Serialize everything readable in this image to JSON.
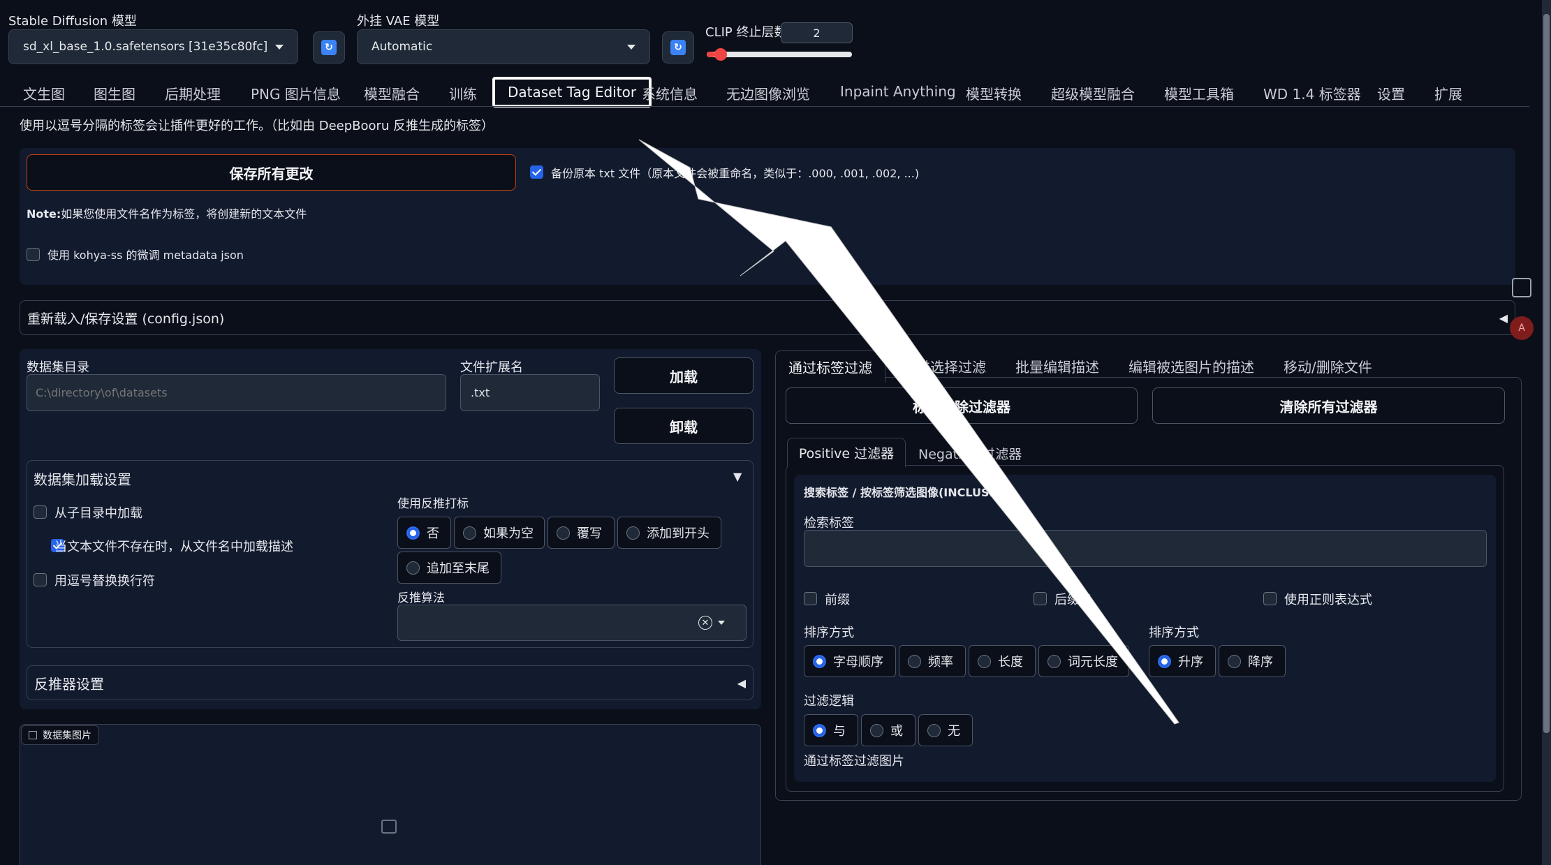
{
  "models": {
    "sd_label": "Stable Diffusion 模型",
    "sd_value": "sd_xl_base_1.0.safetensors [31e35c80fc]",
    "vae_label": "外挂 VAE 模型",
    "vae_value": "Automatic",
    "clip_label": "CLIP 终止层数",
    "clip_value": "2",
    "clip_fraction": 0.06
  },
  "tabs": [
    "文生图",
    "图生图",
    "后期处理",
    "PNG 图片信息",
    "模型融合",
    "训练",
    "Dataset Tag Editor",
    "系统信息",
    "无边图像浏览",
    "Inpaint Anything",
    "模型转换",
    "超级模型融合",
    "模型工具箱",
    "WD 1.4 标签器",
    "设置",
    "扩展"
  ],
  "active_tab": "Dataset Tag Editor",
  "intro": "使用以逗号分隔的标签会让插件更好的工作。（比如由 DeepBooru 反推生成的标签）",
  "save": {
    "button": "保存所有更改",
    "backup_label": "备份原本 txt 文件（原本文件会被重命名，类似于：.000, .001, .002, ...)",
    "note_bold": "Note:",
    "note": "如果您使用文件名作为标签，将创建新的文本文件",
    "kohya_label": "使用 kohya-ss 的微调 metadata json"
  },
  "config_accordion": "重新载入/保存设置 (config.json)",
  "dataset": {
    "dir_label": "数据集目录",
    "dir_placeholder": "C:\\directory\\of\\datasets",
    "ext_label": "文件扩展名",
    "ext_value": ".txt",
    "load": "加载",
    "unload": "卸载"
  },
  "load_settings": {
    "title": "数据集加载设置",
    "opt1": "从子目录中加载",
    "opt2": "当文本文件不存在时，从文件名中加载描述",
    "opt3": "用逗号替换换行符",
    "interrogate_label": "使用反推打标",
    "interrogate_opts": [
      "否",
      "如果为空",
      "覆写",
      "添加到开头",
      "追加至末尾"
    ],
    "algo_label": "反推算法"
  },
  "interrogator_settings": "反推器设置",
  "gallery_label": "数据集图片",
  "right": {
    "tabs": [
      "通过标签过滤",
      "通过选择过滤",
      "批量编辑描述",
      "编辑被选图片的描述",
      "移动/删除文件"
    ],
    "clear_tag_filter": "标签清除过滤器",
    "clear_all_filters": "清除所有过滤器",
    "subtabs": [
      "Positive 过滤器",
      "Negative 过滤器"
    ],
    "search_title": "搜索标签 / 按标签筛选图像(INCLUSIVE)",
    "search_label": "检索标签",
    "chk_prefix": "前缀",
    "chk_suffix": "后缀名",
    "chk_regex": "使用正则表达式",
    "sort_label": "排序方式",
    "sort_opts": [
      "字母顺序",
      "频率",
      "长度",
      "词元长度"
    ],
    "order_label": "排序方式",
    "order_opts": [
      "升序",
      "降序"
    ],
    "logic_label": "过滤逻辑",
    "logic_opts": [
      "与",
      "或",
      "无"
    ],
    "filter_images_label": "通过标签过滤图片"
  },
  "colors": {
    "accent": "#2563eb",
    "save_border": "#c2410c",
    "arrow": "#ffffff"
  }
}
